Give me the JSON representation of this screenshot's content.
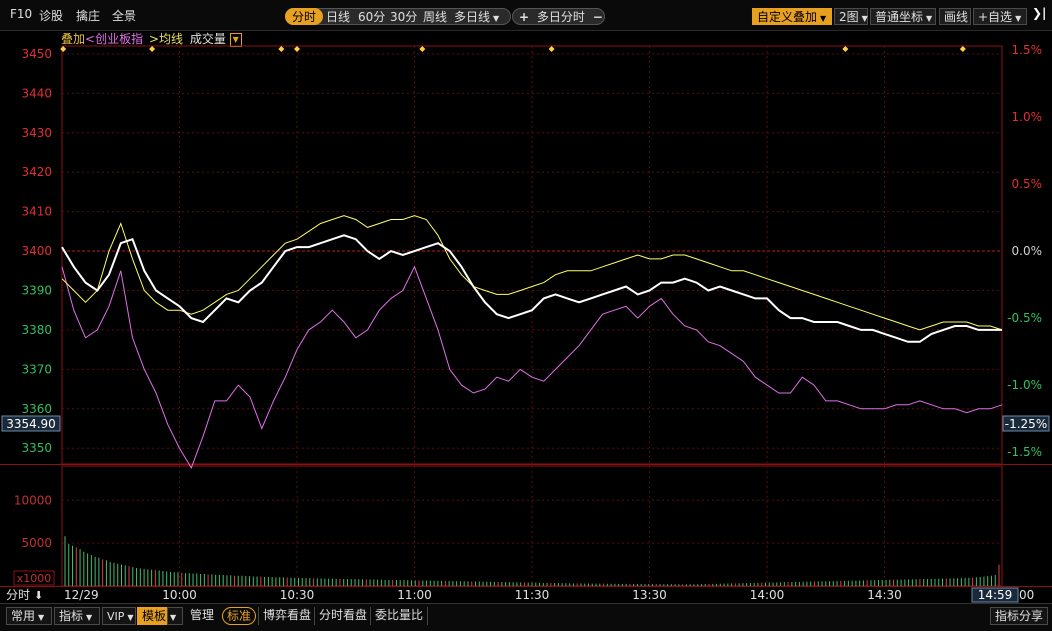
{
  "toolbar": {
    "f10": "F10",
    "diagnose": "诊股",
    "catch_dealer": "擒庄",
    "panorama": "全景",
    "periods": [
      "分时",
      "日线",
      "60分",
      "30分",
      "周线",
      "多日线"
    ],
    "multi_day": "多日分时",
    "plus": "+",
    "minus": "−",
    "custom_overlay": "自定义叠加",
    "two_charts": "2图",
    "normal_coord": "普通坐标",
    "draw_line": "画线",
    "add_watch": "+自选",
    "collapse": "❯|"
  },
  "legend": {
    "overlay": "叠加",
    "chinext_prefix": "<",
    "chinext": "创业板指",
    "avg_prefix": ">",
    "avg": "均线",
    "volume": "成交量"
  },
  "price_panel": {
    "y_labels": [
      "3450",
      "3440",
      "3430",
      "3420",
      "3410",
      "3400",
      "3390",
      "3380",
      "3370",
      "3360",
      "3350"
    ],
    "pct_labels": [
      "1.5%",
      "1.0%",
      "0.5%",
      "0.0%",
      "-0.5%",
      "-1.0%",
      "-1.5%"
    ],
    "current_price": "3354.90",
    "current_pct": "-1.25%",
    "reference_price": 3400.0,
    "ylim": [
      3346,
      3452
    ]
  },
  "volume_panel": {
    "y_labels": [
      "10000",
      "5000"
    ],
    "unit_label": "x1000",
    "ylim": [
      0,
      14000
    ]
  },
  "time_axis": {
    "tick_labels": [
      "12/29",
      "10:00",
      "10:30",
      "11:00",
      "11:30",
      "13:30",
      "14:00",
      "14:30"
    ],
    "mode_label": "分时",
    "mode_arrow": "⬇",
    "current_time": "14:59",
    "end_label": "00"
  },
  "chart_data": {
    "type": "line",
    "x_range": [
      0,
      240
    ],
    "x_ticks": [
      0,
      30,
      60,
      90,
      120,
      150,
      180,
      210
    ],
    "x_tick_labels": [
      "12/29",
      "10:00",
      "10:30",
      "11:00",
      "11:30",
      "13:30",
      "14:00",
      "14:30"
    ],
    "ylabel": "",
    "ylim": [
      3346,
      3452
    ],
    "series": [
      {
        "color": "#ffffff",
        "x": [
          0,
          3,
          6,
          9,
          12,
          15,
          18,
          21,
          24,
          27,
          30,
          33,
          36,
          39,
          42,
          45,
          48,
          51,
          54,
          57,
          60,
          63,
          66,
          69,
          72,
          75,
          78,
          81,
          84,
          87,
          90,
          93,
          96,
          99,
          102,
          105,
          108,
          111,
          114,
          117,
          120,
          123,
          126,
          129,
          132,
          135,
          138,
          141,
          144,
          147,
          150,
          153,
          156,
          159,
          162,
          165,
          168,
          171,
          174,
          177,
          180,
          183,
          186,
          189,
          192,
          195,
          198,
          201,
          204,
          207,
          210,
          213,
          216,
          219,
          222,
          225,
          228,
          231,
          234,
          237,
          240
        ],
        "values": [
          3401,
          3396,
          3392,
          3390,
          3394,
          3402,
          3403,
          3395,
          3390,
          3388,
          3386,
          3383,
          3382,
          3385,
          3388,
          3387,
          3390,
          3392,
          3396,
          3400,
          3401,
          3401,
          3402,
          3403,
          3404,
          3403,
          3400,
          3398,
          3400,
          3399,
          3400,
          3401,
          3402,
          3400,
          3396,
          3391,
          3387,
          3384,
          3383,
          3384,
          3385,
          3388,
          3389,
          3388,
          3387,
          3388,
          3389,
          3390,
          3391,
          3389,
          3390,
          3392,
          3392,
          3393,
          3392,
          3390,
          3391,
          3390,
          3389,
          3388,
          3388,
          3385,
          3383,
          3383,
          3382,
          3382,
          3382,
          3381,
          3380,
          3380,
          3379,
          3378,
          3377,
          3377,
          3379,
          3380,
          3381,
          3381,
          3380,
          3380,
          3380
        ]
      },
      {
        "color": "#ffff66",
        "x": [
          0,
          3,
          6,
          9,
          12,
          15,
          18,
          21,
          24,
          27,
          30,
          33,
          36,
          39,
          42,
          45,
          48,
          51,
          54,
          57,
          60,
          63,
          66,
          69,
          72,
          75,
          78,
          81,
          84,
          87,
          90,
          93,
          96,
          99,
          102,
          105,
          108,
          111,
          114,
          117,
          120,
          123,
          126,
          129,
          132,
          135,
          138,
          141,
          144,
          147,
          150,
          153,
          156,
          159,
          162,
          165,
          168,
          171,
          174,
          177,
          180,
          183,
          186,
          189,
          192,
          195,
          198,
          201,
          204,
          207,
          210,
          213,
          216,
          219,
          222,
          225,
          228,
          231,
          234,
          237,
          240
        ],
        "values": [
          3393,
          3390,
          3387,
          3390,
          3400,
          3407,
          3398,
          3390,
          3387,
          3385,
          3385,
          3384,
          3385,
          3387,
          3389,
          3390,
          3393,
          3396,
          3399,
          3402,
          3403,
          3405,
          3407,
          3408,
          3409,
          3408,
          3406,
          3407,
          3408,
          3408,
          3409,
          3408,
          3404,
          3398,
          3394,
          3391,
          3390,
          3389,
          3389,
          3390,
          3391,
          3392,
          3394,
          3395,
          3395,
          3395,
          3396,
          3397,
          3398,
          3399,
          3398,
          3398,
          3399,
          3399,
          3398,
          3397,
          3396,
          3395,
          3395,
          3394,
          3393,
          3392,
          3391,
          3390,
          3389,
          3388,
          3387,
          3386,
          3385,
          3384,
          3383,
          3382,
          3381,
          3380,
          3381,
          3382,
          3382,
          3382,
          3381,
          3381,
          3380
        ]
      },
      {
        "color": "#e070e8",
        "x": [
          0,
          3,
          6,
          9,
          12,
          15,
          18,
          21,
          24,
          27,
          30,
          33,
          36,
          39,
          42,
          45,
          48,
          51,
          54,
          57,
          60,
          63,
          66,
          69,
          72,
          75,
          78,
          81,
          84,
          87,
          90,
          93,
          96,
          99,
          102,
          105,
          108,
          111,
          114,
          117,
          120,
          123,
          126,
          129,
          132,
          135,
          138,
          141,
          144,
          147,
          150,
          153,
          156,
          159,
          162,
          165,
          168,
          171,
          174,
          177,
          180,
          183,
          186,
          189,
          192,
          195,
          198,
          201,
          204,
          207,
          210,
          213,
          216,
          219,
          222,
          225,
          228,
          231,
          234,
          237,
          240
        ],
        "values": [
          3396,
          3385,
          3378,
          3380,
          3386,
          3395,
          3378,
          3370,
          3364,
          3356,
          3350,
          3345,
          3353,
          3362,
          3362,
          3366,
          3363,
          3355,
          3362,
          3368,
          3375,
          3380,
          3382,
          3385,
          3382,
          3378,
          3380,
          3385,
          3388,
          3390,
          3396,
          3388,
          3380,
          3370,
          3366,
          3364,
          3365,
          3368,
          3367,
          3370,
          3368,
          3367,
          3370,
          3373,
          3376,
          3380,
          3384,
          3385,
          3386,
          3383,
          3386,
          3388,
          3384,
          3381,
          3380,
          3377,
          3376,
          3374,
          3372,
          3368,
          3366,
          3364,
          3364,
          3368,
          3366,
          3362,
          3362,
          3361,
          3360,
          3360,
          3360,
          3361,
          3361,
          3362,
          3361,
          3360,
          3360,
          3359,
          3360,
          3360,
          3361
        ]
      }
    ],
    "volume": {
      "type": "bar",
      "ylim": [
        0,
        14000
      ],
      "values": [
        5800,
        4900,
        4700,
        4500,
        4300,
        4000,
        3800,
        3600,
        3400,
        3300,
        3100,
        3000,
        2800,
        2700,
        2600,
        2500,
        2400,
        2300,
        2200,
        2100,
        2050,
        2000,
        1950,
        1900,
        1850,
        1800,
        1750,
        1700,
        1650,
        1600,
        1600,
        1550,
        1500,
        1500,
        1450,
        1450,
        1400,
        1400,
        1350,
        1350,
        1300,
        1300,
        1300,
        1250,
        1250,
        1200,
        1200,
        1200,
        1150,
        1150,
        1100,
        1100,
        1100,
        1050,
        1050,
        1050,
        1000,
        1000,
        1000,
        980,
        960,
        950,
        940,
        930,
        920,
        910,
        900,
        890,
        880,
        870,
        860,
        850,
        840,
        830,
        820,
        810,
        800,
        800,
        790,
        780,
        770,
        760,
        750,
        740,
        730,
        720,
        710,
        700,
        700,
        690,
        680,
        670,
        660,
        650,
        650,
        640,
        630,
        620,
        610,
        600,
        600,
        590,
        580,
        570,
        560,
        550,
        550,
        540,
        530,
        520,
        510,
        500,
        500,
        490,
        480,
        470,
        460,
        450,
        450,
        440,
        430,
        420,
        410,
        400,
        400,
        390,
        380,
        370,
        360,
        350,
        350,
        340,
        330,
        320,
        310,
        300,
        300,
        300,
        290,
        290,
        280,
        280,
        270,
        270,
        260,
        260,
        260,
        250,
        250,
        250,
        240,
        240,
        240,
        230,
        230,
        230,
        220,
        220,
        220,
        210,
        210,
        210,
        200,
        200,
        200,
        200,
        200,
        200,
        210,
        220,
        230,
        240,
        250,
        260,
        270,
        280,
        290,
        300,
        310,
        320,
        330,
        340,
        350,
        360,
        370,
        380,
        390,
        400,
        410,
        420,
        430,
        440,
        450,
        460,
        470,
        480,
        490,
        500,
        510,
        520,
        530,
        540,
        550,
        560,
        570,
        580,
        590,
        600,
        610,
        620,
        630,
        640,
        650,
        660,
        670,
        680,
        690,
        700,
        710,
        720,
        730,
        740,
        750,
        760,
        770,
        780,
        790,
        800,
        810,
        820,
        830,
        840,
        850,
        860,
        870,
        880,
        890,
        900,
        920,
        940,
        960,
        980,
        1000,
        1050,
        1100,
        1150,
        1200,
        1300,
        2500
      ]
    }
  },
  "bottombar": {
    "common": "常用",
    "indicator": "指标",
    "vip": "VIP",
    "template": "模板",
    "manage": "管理",
    "standard": "标准",
    "game_watch": "博弈看盘",
    "timeshare_watch": "分时看盘",
    "bid_ratio": "委比量比",
    "indicator_share": "指标分享"
  }
}
